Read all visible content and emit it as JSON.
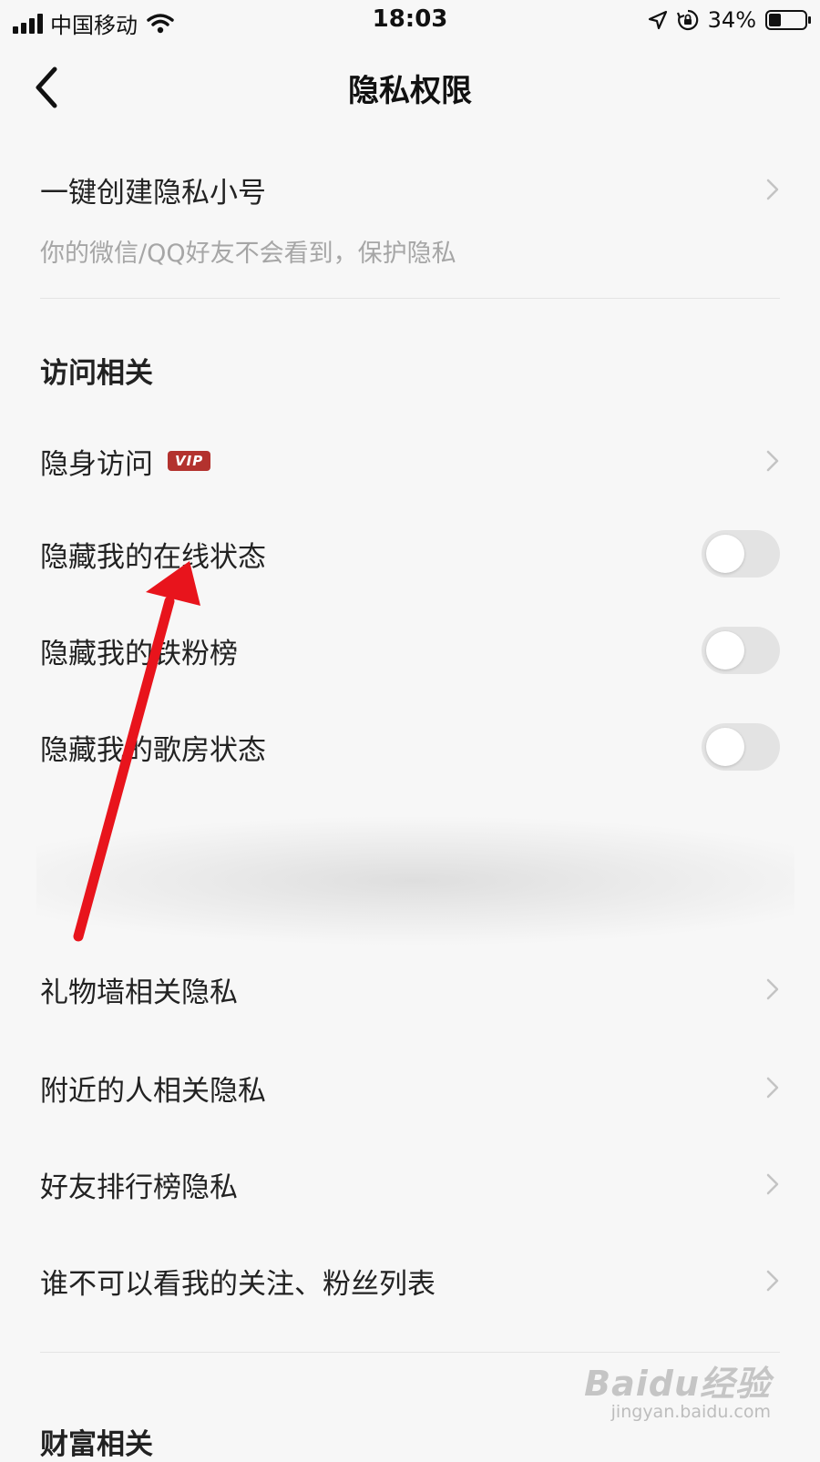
{
  "status_bar": {
    "carrier": "中国移动",
    "time": "18:03",
    "battery_percent": "34%",
    "battery_level": 0.34
  },
  "header": {
    "title": "隐私权限"
  },
  "privacy_account": {
    "label": "一键创建隐私小号",
    "description": "你的微信/QQ好友不会看到，保护隐私"
  },
  "access_section": {
    "title": "访问相关",
    "items": [
      {
        "label": "隐身访问",
        "badge": "VIP",
        "control": "chevron"
      },
      {
        "label": "隐藏我的在线状态",
        "control": "toggle",
        "on": false
      },
      {
        "label": "隐藏我的铁粉榜",
        "control": "toggle",
        "on": false
      },
      {
        "label": "隐藏我的歌房状态",
        "control": "toggle",
        "on": false
      }
    ]
  },
  "more_items": [
    {
      "label": "礼物墙相关隐私"
    },
    {
      "label": "附近的人相关隐私"
    },
    {
      "label": "好友排行榜隐私"
    },
    {
      "label": "谁不可以看我的关注、粉丝列表"
    }
  ],
  "wealth_section": {
    "title": "财富相关"
  },
  "watermark": {
    "logo": "Baidu经验",
    "url": "jingyan.baidu.com"
  },
  "colors": {
    "background": "#f7f7f7",
    "vip_badge": "#b3322e",
    "annotation_arrow": "#e8141c",
    "toggle_off": "#e3e3e3"
  }
}
